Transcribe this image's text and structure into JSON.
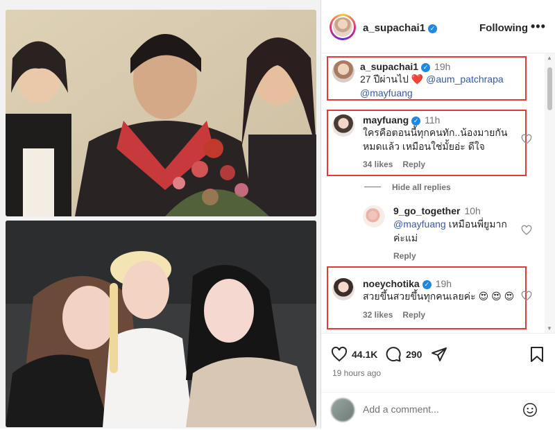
{
  "post": {
    "username": "a_supachai1",
    "follow_state": "Following",
    "more_label": "•••"
  },
  "comments": [
    {
      "username": "a_supachai1",
      "time": "19h",
      "text_prefix": "27  ปีผ่านไป ",
      "heart": "❤️",
      "mention1": "@aum_patchrapa",
      "mention2": "@mayfuang",
      "highlighted": true
    },
    {
      "username": "mayfuang",
      "time": "11h",
      "line1": "ใครคือตอนนี้ทุกคนทัก..น้องมายกัน",
      "line2": "หมดแล้ว เหมือนใช่มั้ยอ่ะ ดีใจ",
      "likes": "34 likes",
      "reply": "Reply",
      "highlighted": true
    },
    {
      "username": "9_go_together",
      "time": "10h",
      "mention": "@mayfuang",
      "line1_rest": " เหมือนพี่ยูมาก",
      "line2": "ค่ะแม่",
      "reply": "Reply",
      "highlighted": false
    },
    {
      "username": "noeychotika",
      "time": "19h",
      "text": "สวยขึ้นสวยขึ้นทุกคนเลยค่ะ",
      "emojis": "😍 😍 😍",
      "likes": "32 likes",
      "reply": "Reply",
      "highlighted": true
    }
  ],
  "hide_replies": "Hide all replies",
  "actions": {
    "likes_count": "44.1K",
    "comments_count": "290",
    "posted_ago": "19 hours ago"
  },
  "add_comment": {
    "placeholder": "Add a comment..."
  },
  "colors": {
    "verified": "#1e88e5",
    "mention": "#385aa8",
    "highlight_box": "#e53935"
  }
}
